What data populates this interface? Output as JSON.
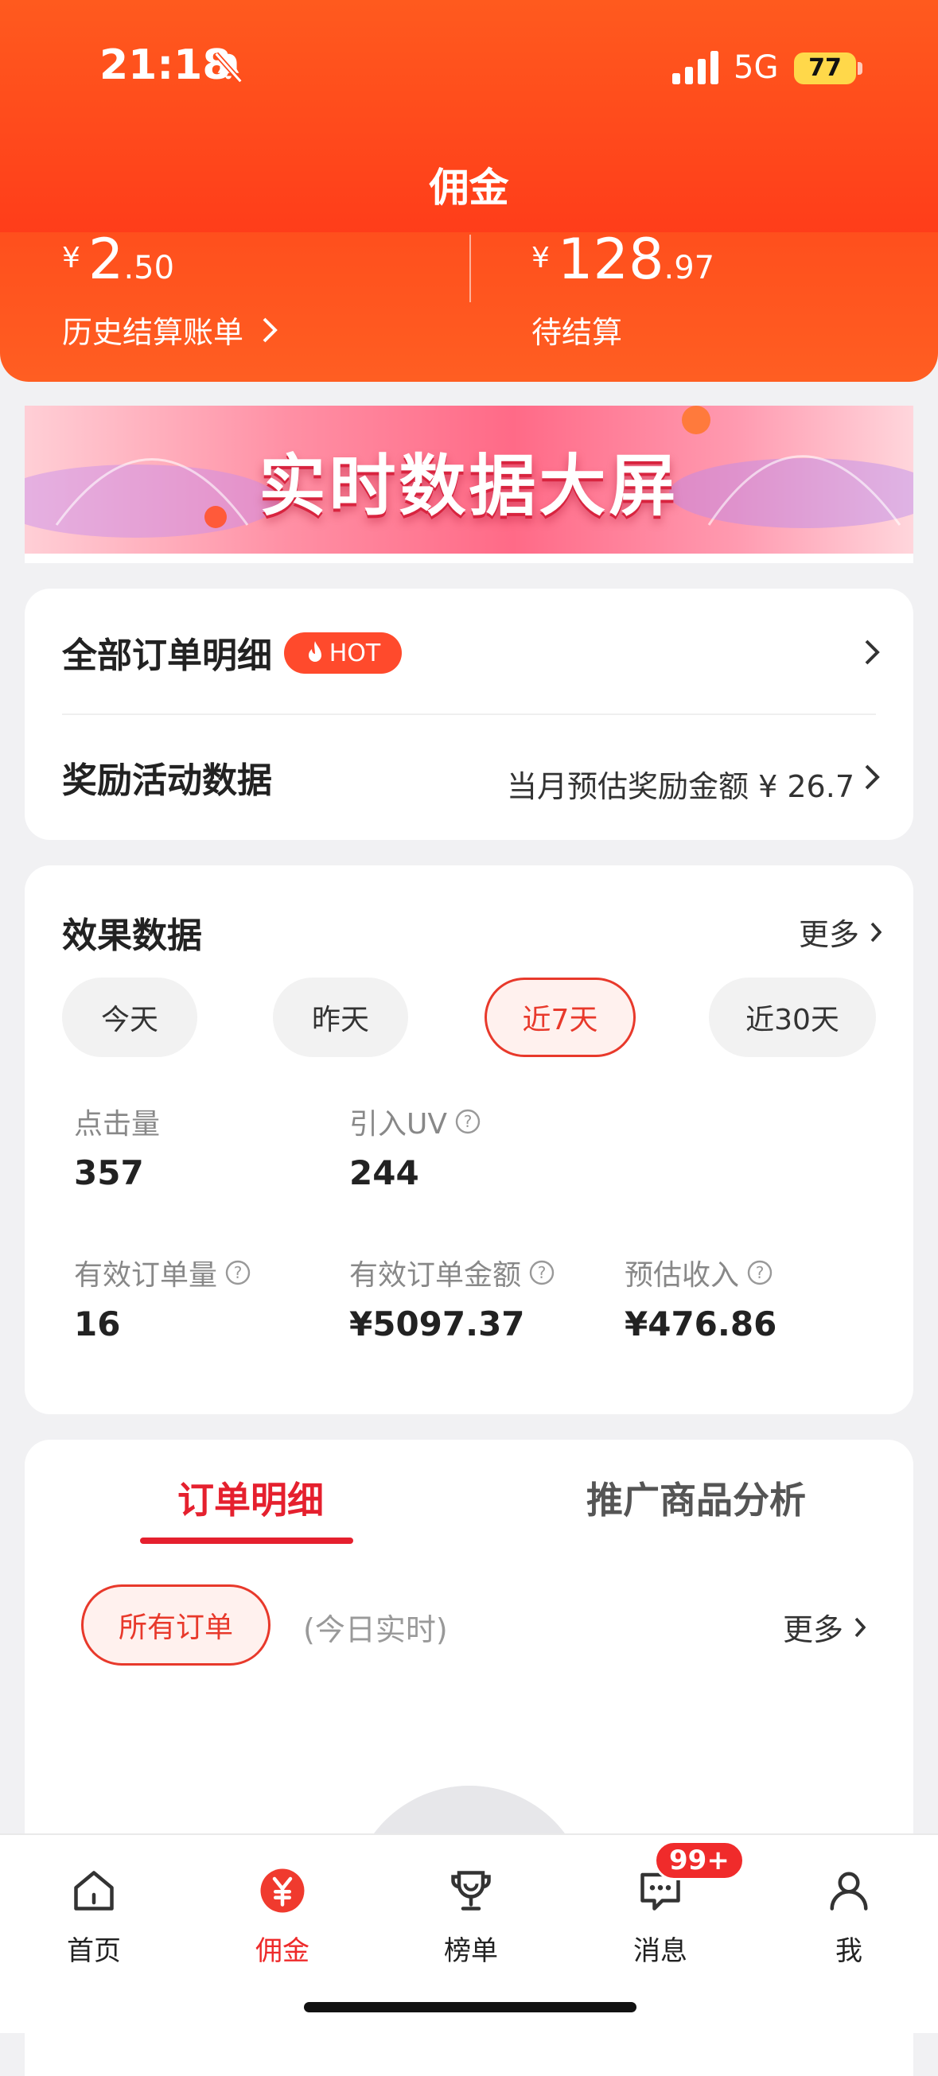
{
  "status_bar": {
    "time": "21:18",
    "network": "5G",
    "battery": "77"
  },
  "header": {
    "title": "佣金",
    "settled": {
      "currency": "¥",
      "int": "2",
      "dec": ".50",
      "link_label": "历史结算账单"
    },
    "pending": {
      "currency": "¥",
      "int": "128",
      "dec": ".97",
      "label": "待结算"
    }
  },
  "banner": {
    "text": "实时数据大屏"
  },
  "order_card": {
    "all_orders_label": "全部订单明细",
    "hot_badge": "HOT",
    "reward_label": "奖励活动数据",
    "reward_value": "当月预估奖励金额 ¥ 26.7"
  },
  "effect": {
    "title": "效果数据",
    "more": "更多",
    "ranges": [
      "今天",
      "昨天",
      "近7天",
      "近30天"
    ],
    "active_range": "近7天",
    "metrics": {
      "clicks": {
        "label": "点击量",
        "value": "357"
      },
      "uv": {
        "label": "引入UV",
        "value": "244"
      },
      "orders": {
        "label": "有效订单量",
        "value": "16"
      },
      "order_amount": {
        "label": "有效订单金额",
        "value": "¥5097.37"
      },
      "income": {
        "label": "预估收入",
        "value": "¥476.86"
      }
    }
  },
  "detail": {
    "tabs": [
      "订单明细",
      "推广商品分析"
    ],
    "active_tab": "订单明细",
    "filter": "所有订单",
    "realtime": "(今日实时)",
    "more": "更多"
  },
  "nav": {
    "items": [
      "首页",
      "佣金",
      "榜单",
      "消息",
      "我"
    ],
    "active": "佣金",
    "message_badge": "99+"
  },
  "colors": {
    "accent": "#ff4d1c",
    "active_red": "#e8392b",
    "background": "#f1f1f3"
  }
}
